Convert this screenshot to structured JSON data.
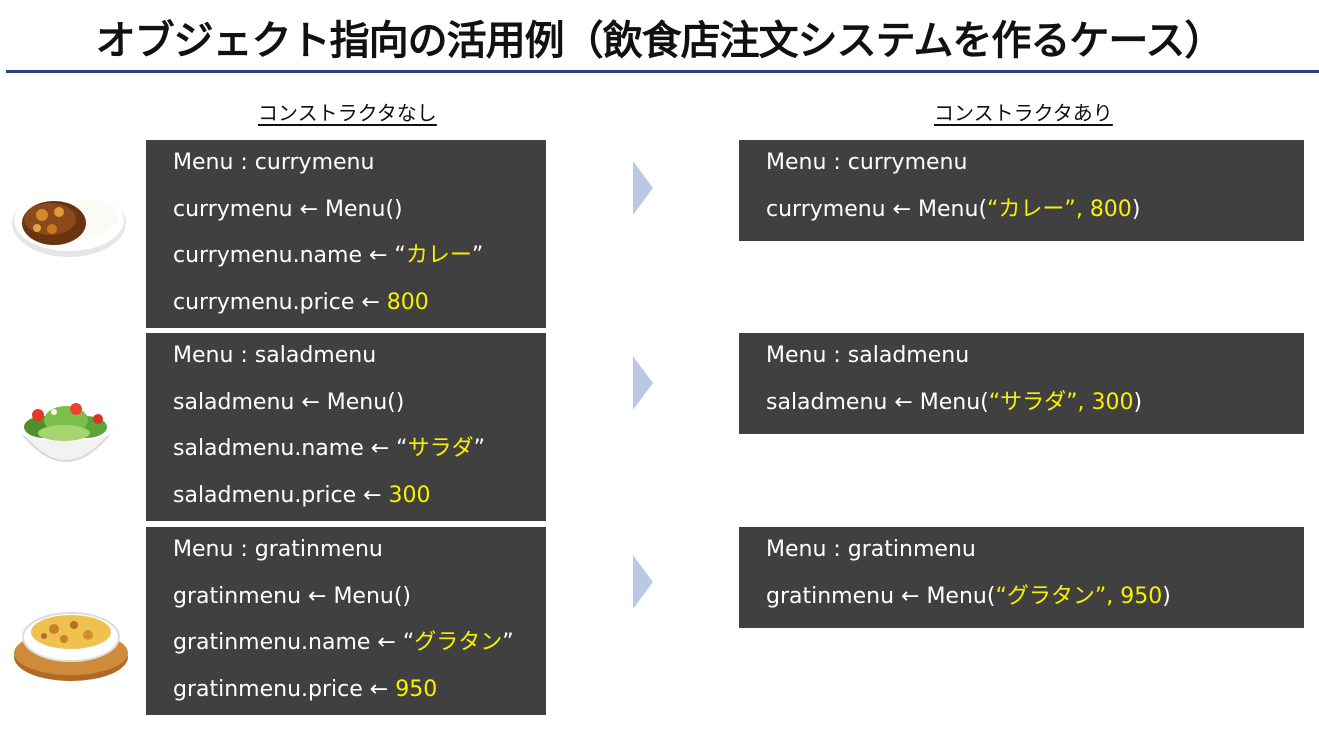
{
  "title": "オブジェクト指向の活用例（飲食店注文システムを作るケース）",
  "left_heading": "コンストラクタなし",
  "right_heading": "コンストラクタあり",
  "left_blocks": [
    {
      "dish_icon": "curry-rice-icon",
      "decl": "Menu : currymenu",
      "ctor": "currymenu ← Menu()",
      "name_prefix": "currymenu.name ← “",
      "name_value": "カレー",
      "name_suffix": "”",
      "price_prefix": "currymenu.price ← ",
      "price_value": "800"
    },
    {
      "dish_icon": "salad-icon",
      "decl": "Menu : saladmenu",
      "ctor": "saladmenu ← Menu()",
      "name_prefix": "saladmenu.name ← “",
      "name_value": "サラダ",
      "name_suffix": "”",
      "price_prefix": "saladmenu.price ← ",
      "price_value": "300"
    },
    {
      "dish_icon": "gratin-icon",
      "decl": "Menu : gratinmenu",
      "ctor": "gratinmenu ← Menu()",
      "name_prefix": "gratinmenu.name ← “",
      "name_value": "グラタン",
      "name_suffix": "”",
      "price_prefix": "gratinmenu.price ← ",
      "price_value": "950"
    }
  ],
  "right_blocks": [
    {
      "decl": "Menu : currymenu",
      "ctor_prefix": "currymenu ← Menu(",
      "args": "“カレー”, 800",
      "ctor_suffix": ")"
    },
    {
      "decl": "Menu : saladmenu",
      "ctor_prefix": "saladmenu ← Menu(",
      "args": "“サラダ”, 300",
      "ctor_suffix": ")"
    },
    {
      "decl": "Menu : gratinmenu",
      "ctor_prefix": "gratinmenu ← Menu(",
      "args": "“グラタン”, 950",
      "ctor_suffix": ")"
    }
  ],
  "colors": {
    "code_background": "#404040",
    "highlight": "#f7f000",
    "arrow": "#b9c9e4",
    "title_rule": "#2f3d7a"
  }
}
